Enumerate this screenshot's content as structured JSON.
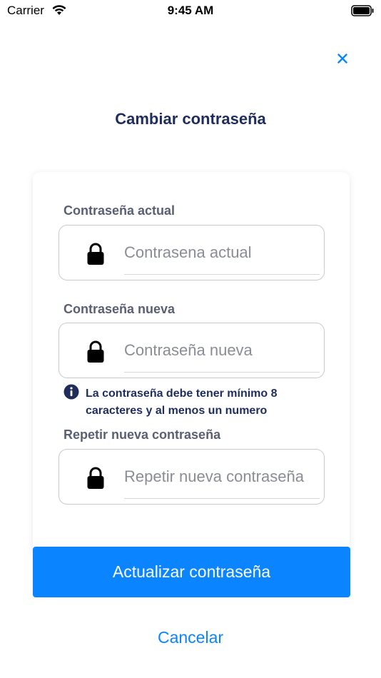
{
  "status_bar": {
    "carrier": "Carrier",
    "time": "9:45 AM"
  },
  "header": {
    "title": "Cambiar contraseña"
  },
  "fields": [
    {
      "label": "Contraseña actual",
      "placeholder": "Contrasena actual",
      "value": ""
    },
    {
      "label": "Contraseña nueva",
      "placeholder": "Contraseña nueva",
      "value": ""
    },
    {
      "label": "Repetir nueva contraseña",
      "placeholder": "Repetir nueva contraseña",
      "value": ""
    }
  ],
  "hint": {
    "text": "La contraseña debe tener mínimo 8 caracteres y al menos un numero"
  },
  "actions": {
    "submit_label": "Actualizar contraseña",
    "cancel_label": "Cancelar"
  },
  "icons": {
    "close": "close-icon",
    "lock": "lock-icon",
    "info": "info-icon",
    "wifi": "wifi-icon",
    "battery": "battery-icon"
  },
  "colors": {
    "accent": "#0a84ff",
    "title": "#1f2d5c",
    "label": "#5a6074"
  }
}
